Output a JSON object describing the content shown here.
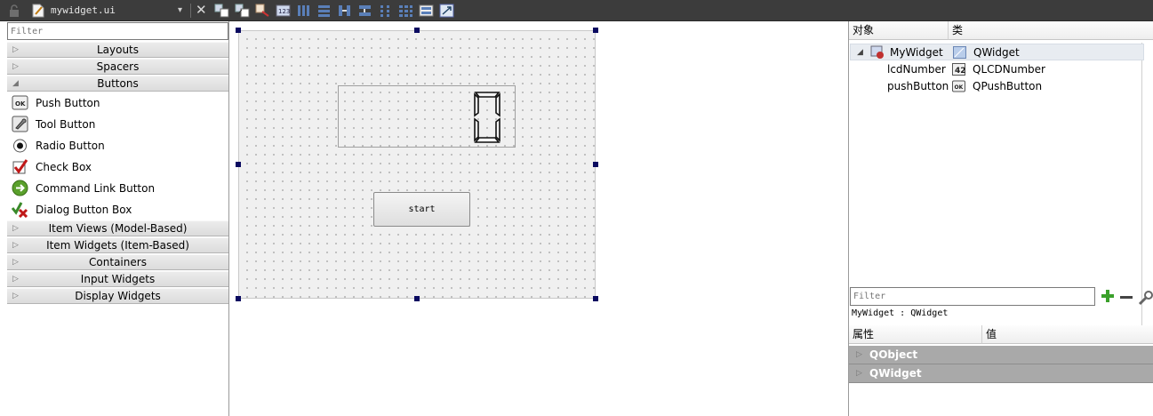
{
  "toolbar": {
    "filename": "mywidget.ui",
    "dropdown_glyph": "▾",
    "close_glyph": "✕",
    "buttons": [
      "edit-widgets-icon",
      "edit-signals-slots-icon",
      "edit-buddies-icon",
      "edit-tab-order-icon",
      "layout-horizontal-icon",
      "layout-vertical-icon",
      "layout-horizontal-splitter-icon",
      "layout-vertical-splitter-icon",
      "layout-form-icon",
      "layout-grid-icon",
      "break-layout-icon",
      "adjust-size-icon"
    ]
  },
  "widget_box": {
    "filter_placeholder": "Filter",
    "categories_top": [
      {
        "label": "Layouts",
        "arrow": "▷"
      },
      {
        "label": "Spacers",
        "arrow": "▷"
      },
      {
        "label": "Buttons",
        "arrow": "◢"
      }
    ],
    "button_items": [
      {
        "label": "Push Button",
        "icon": "push-button-icon"
      },
      {
        "label": "Tool Button",
        "icon": "tool-button-icon"
      },
      {
        "label": "Radio Button",
        "icon": "radio-button-icon"
      },
      {
        "label": "Check Box",
        "icon": "check-box-icon"
      },
      {
        "label": "Command Link Button",
        "icon": "command-link-icon"
      },
      {
        "label": "Dialog Button Box",
        "icon": "dialog-button-box-icon"
      }
    ],
    "categories_bottom": [
      {
        "label": "Item Views (Model-Based)",
        "arrow": "▷"
      },
      {
        "label": "Item Widgets (Item-Based)",
        "arrow": "▷"
      },
      {
        "label": "Containers",
        "arrow": "▷"
      },
      {
        "label": "Input Widgets",
        "arrow": "▷"
      },
      {
        "label": "Display Widgets",
        "arrow": "▷"
      }
    ]
  },
  "form": {
    "lcd_value": 0,
    "start_button_label": "start"
  },
  "object_inspector": {
    "col_object": "对象",
    "col_class": "类",
    "rows": [
      {
        "name": "MyWidget",
        "type": "QWidget",
        "expander": "◢",
        "selected": true
      },
      {
        "name": "lcdNumber",
        "type": "QLCDNumber"
      },
      {
        "name": "pushButton",
        "type": "QPushButton"
      }
    ]
  },
  "property_editor": {
    "filter_placeholder": "Filter",
    "context": "MyWidget : QWidget",
    "col_property": "属性",
    "col_value": "值",
    "groups": [
      {
        "label": "QObject",
        "arrow": "▷"
      },
      {
        "label": "QWidget",
        "arrow": "▷"
      }
    ]
  },
  "colors": {
    "toolbar_bg": "#3c3c3c",
    "group_row_bg": "#a9a9a9",
    "handle": "#0a0a60",
    "plus_green": "#3aa02a"
  }
}
